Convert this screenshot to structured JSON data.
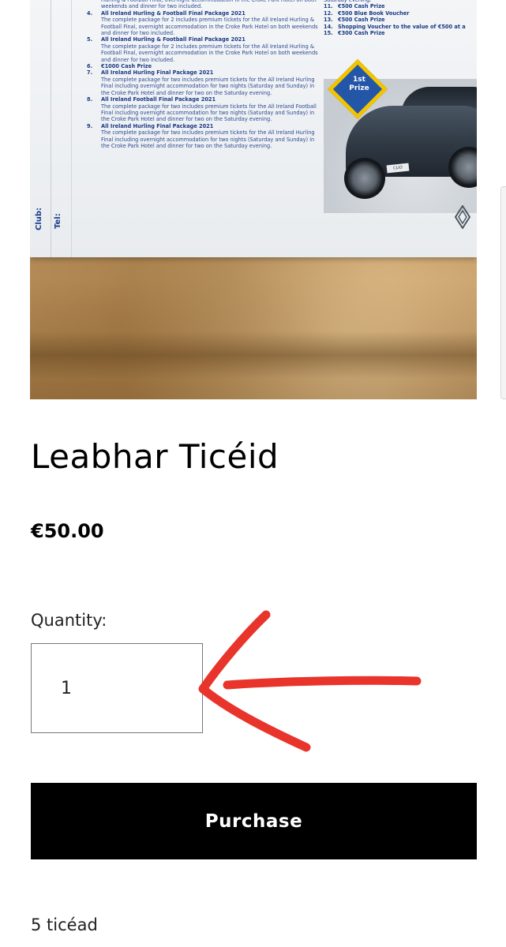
{
  "product_image": {
    "prizes_left": [
      {
        "num": "",
        "title": "",
        "desc": "Hurling & Football Final, overnight accommodation in the Croke Park Hotel on both weekends and dinner for two included."
      },
      {
        "num": "4.",
        "title": "All Ireland Hurling & Football Final Package 2021",
        "desc": "The complete package for 2 includes premium tickets for the All Ireland Hurling & Football Final, overnight accommodation in the Croke Park Hotel on both weekends and dinner for two included."
      },
      {
        "num": "5.",
        "title": "All Ireland Hurling & Football Final Package 2021",
        "desc": "The complete package for 2 includes premium tickets for the All Ireland Hurling & Football Final, overnight accommodation in the Croke Park Hotel on both weekends and dinner for two included."
      },
      {
        "num": "6.",
        "title": "€1000 Cash Prize",
        "desc": ""
      },
      {
        "num": "7.",
        "title": "All Ireland Hurling Final Package 2021",
        "desc": "The complete package for two includes premium tickets for the All Ireland Hurling Final including overnight accommodation for two nights (Saturday and Sunday) in the Croke Park Hotel and dinner for two on the Saturday evening."
      },
      {
        "num": "8.",
        "title": "All Ireland Football Final Package 2021",
        "desc": "The complete package for two includes premium tickets for the All Ireland Football Final including overnight accommodation for two nights (Saturday and Sunday) in the Croke Park Hotel and dinner for two on the Saturday evening."
      },
      {
        "num": "9.",
        "title": "All Ireland Hurling Final Package 2021",
        "desc": "The complete package for two includes premium tickets for the All Ireland Hurling Final including overnight accommodation for two nights (Saturday and Sunday) in the Croke Park Hotel and dinner for two on the Saturday evening."
      }
    ],
    "prizes_right": [
      {
        "num": "",
        "title": "",
        "desc": "Saturday evening."
      },
      {
        "num": "11.",
        "title": "€500 Cash Prize",
        "desc": ""
      },
      {
        "num": "12.",
        "title": "€500 Blue Book Voucher",
        "desc": ""
      },
      {
        "num": "13.",
        "title": "€500 Cash Prize",
        "desc": ""
      },
      {
        "num": "14.",
        "title": "Shopping Voucher to the value of €500 at a",
        "desc": ""
      },
      {
        "num": "15.",
        "title": "€300 Cash Prize",
        "desc": ""
      }
    ],
    "margin_labels": {
      "club": "Club:",
      "tel": "Tel:"
    },
    "badge": {
      "line1": "1st",
      "line2": "Prize"
    },
    "plate_text": "CLIO"
  },
  "product": {
    "title": "Leabhar Ticéid",
    "price": "€50.00",
    "quantity_label": "Quantity:",
    "quantity_value": "1",
    "purchase_label": "Purchase",
    "tickets_note": "5 ticéad"
  },
  "colors": {
    "annotation_arrow": "#e8342b",
    "button_bg": "#000000",
    "button_text": "#ffffff",
    "print_blue": "#1b3a85"
  },
  "icons": {
    "annotation": "red-hand-drawn-arrow-icon",
    "brand": "renault-logo-icon"
  }
}
